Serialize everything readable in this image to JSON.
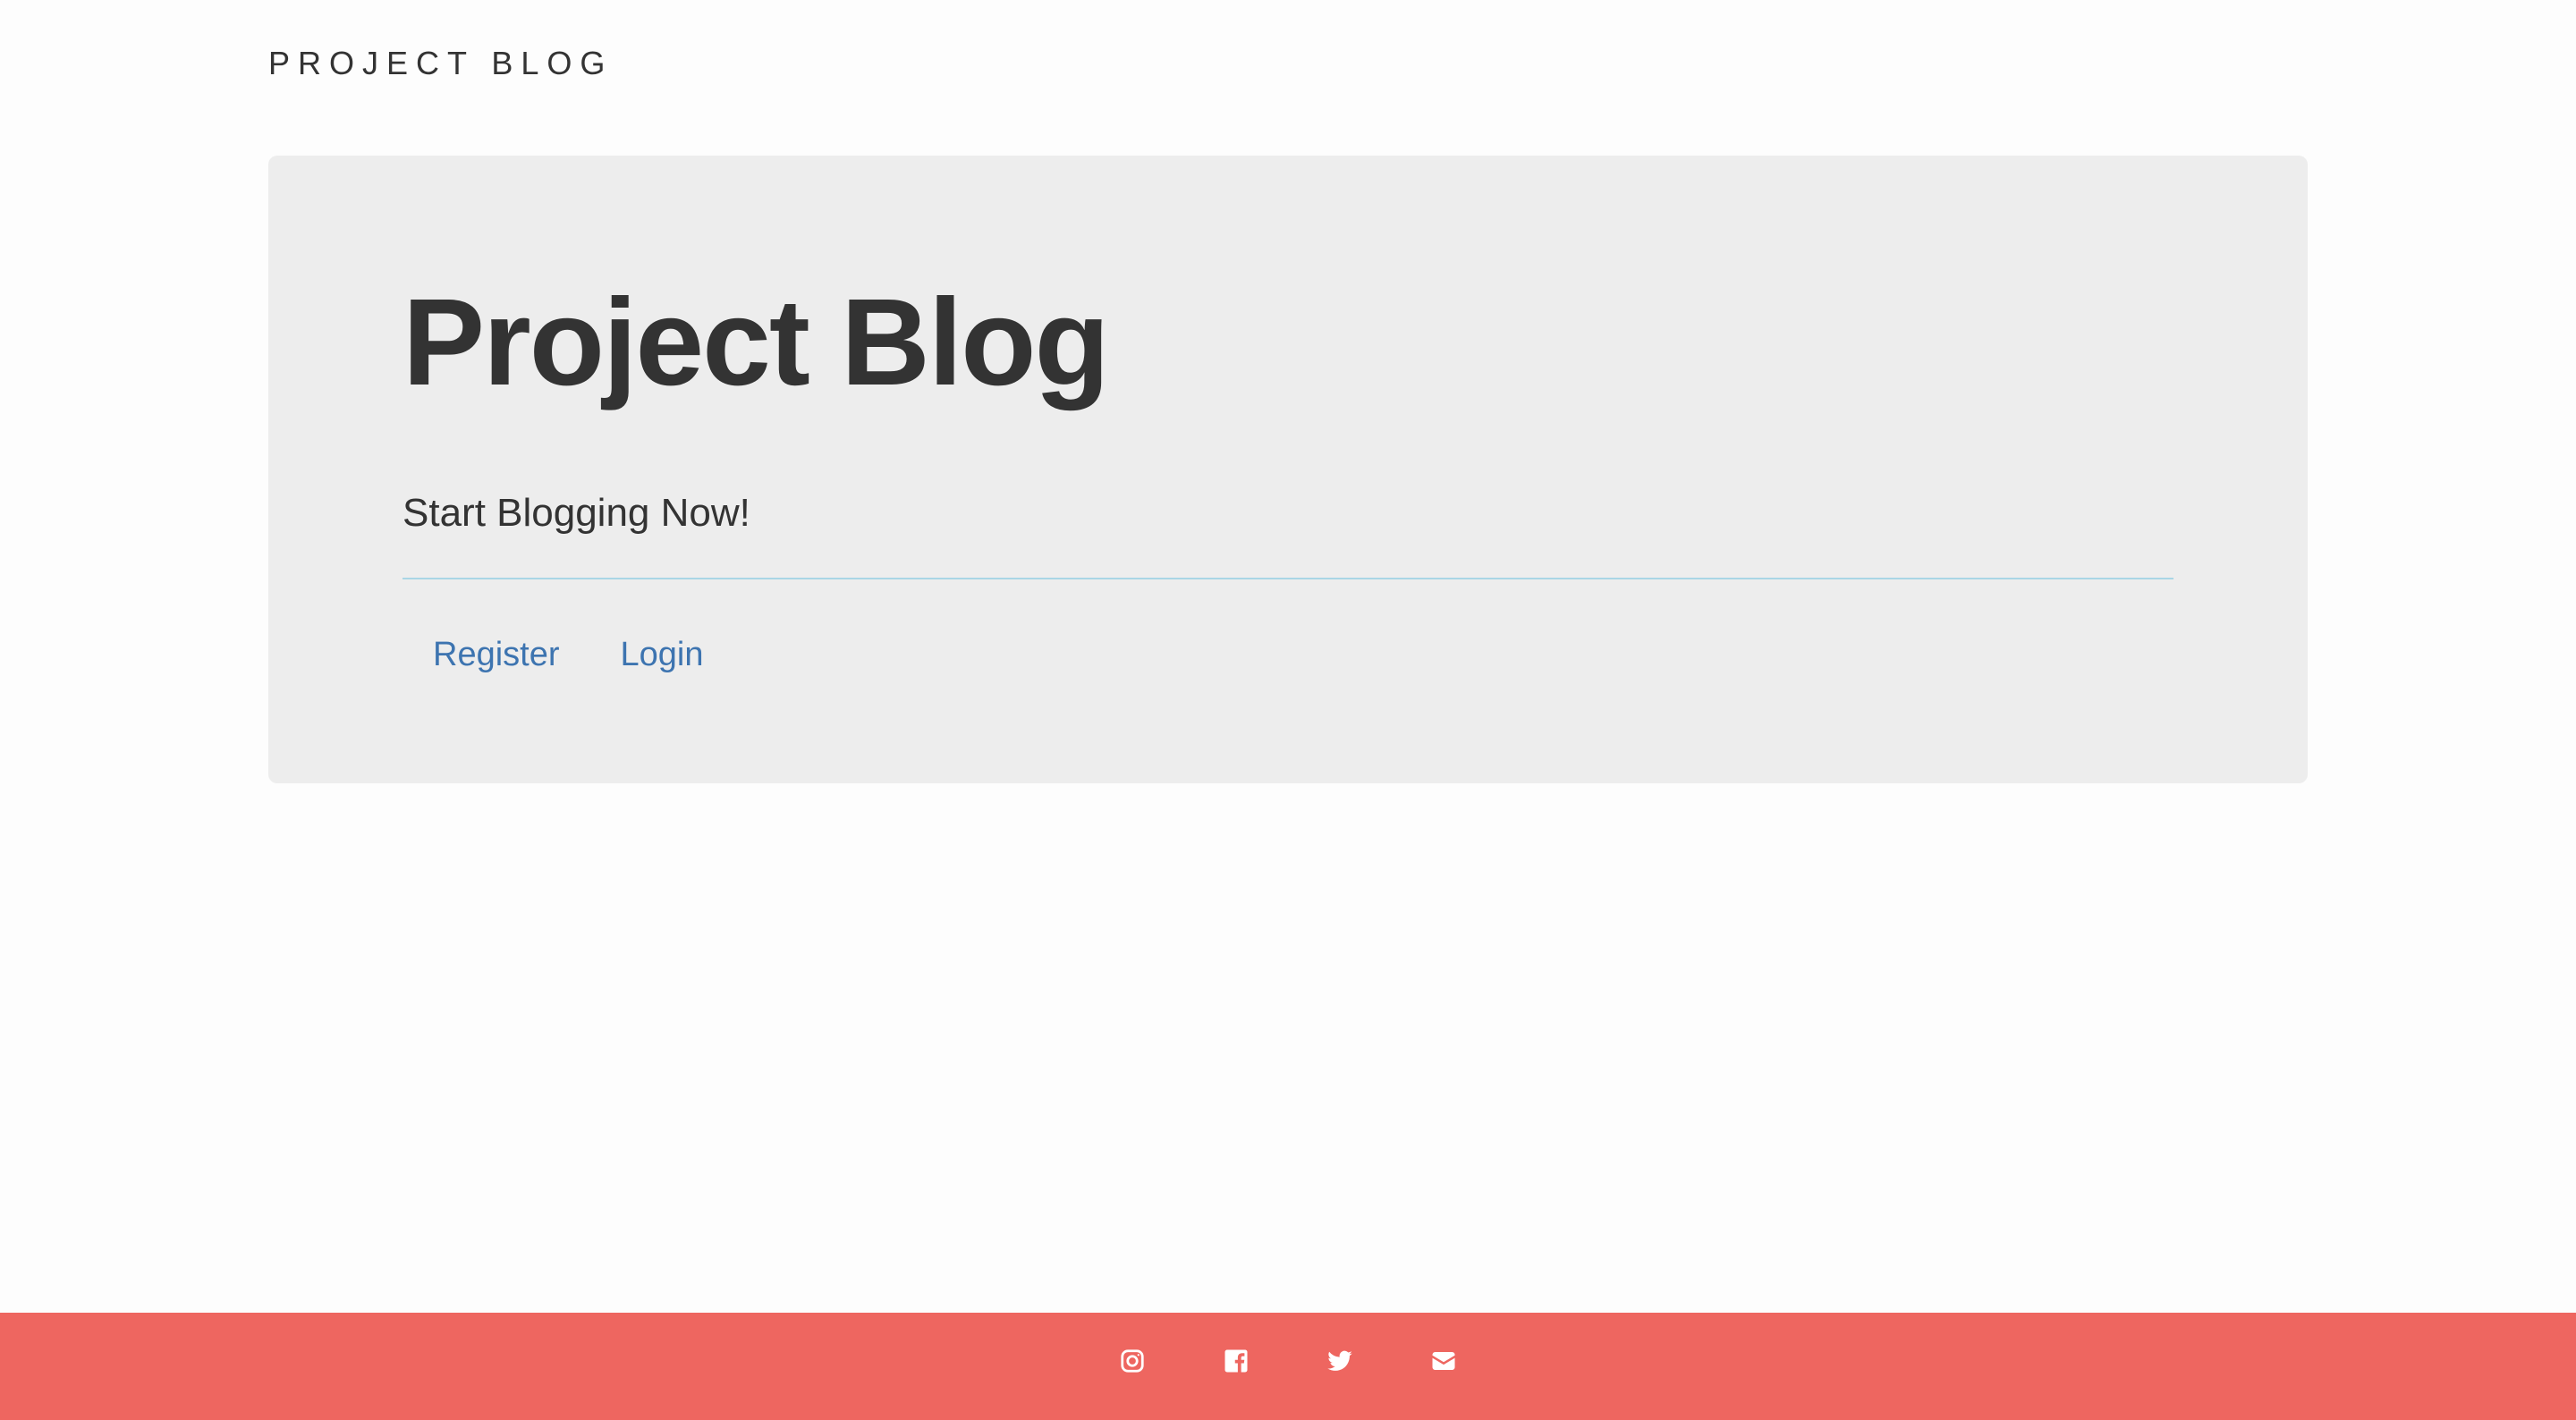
{
  "header": {
    "brand": "PROJECT BLOG"
  },
  "hero": {
    "title": "Project Blog",
    "subtitle": "Start Blogging Now!",
    "links": [
      {
        "label": "Register"
      },
      {
        "label": "Login"
      }
    ]
  },
  "footer": {
    "background_color": "#ee6660",
    "social_icons": [
      "instagram-icon",
      "facebook-icon",
      "twitter-icon",
      "email-icon"
    ]
  },
  "colors": {
    "link": "#3d74b0",
    "jumbotron_bg": "#ededed",
    "divider": "#a9d6e5",
    "text": "#333333"
  }
}
